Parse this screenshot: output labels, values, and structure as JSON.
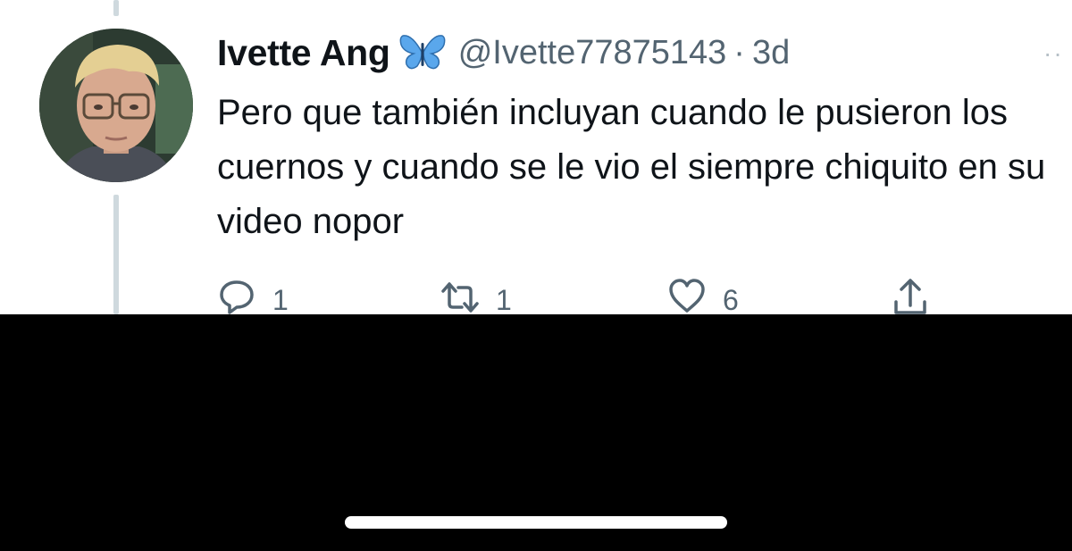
{
  "tweet": {
    "display_name": "Ivette Ang",
    "name_emoji": "butterfly-emoji",
    "handle": "@Ivette77875143",
    "separator": "·",
    "time": "3d",
    "more_icon": "more-dots-icon",
    "text": "Pero que también incluyan cuando le pusieron los cuernos y cuando se le vio el siempre chiquito en su video nopor",
    "actions": {
      "reply": {
        "icon": "reply-icon",
        "count": "1"
      },
      "retweet": {
        "icon": "retweet-icon",
        "count": "1"
      },
      "like": {
        "icon": "heart-icon",
        "count": "6"
      },
      "share": {
        "icon": "share-icon"
      }
    }
  },
  "colors": {
    "text": "#0f1419",
    "muted": "#536471",
    "thread_line": "#cfd9de",
    "butterfly": "#5aa7ec",
    "bottom_panel": "#000000",
    "home_indicator": "#ffffff"
  }
}
